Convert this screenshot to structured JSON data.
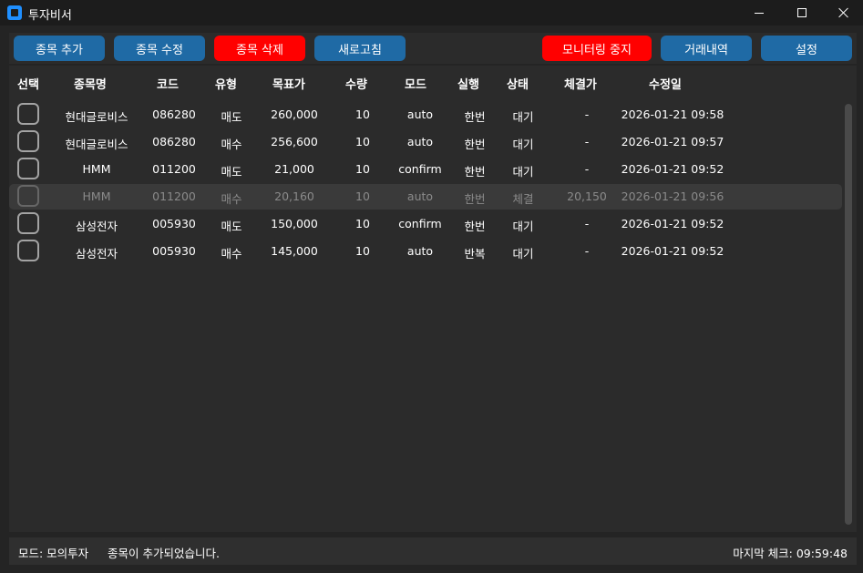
{
  "window": {
    "title": "투자비서",
    "controls": {
      "minimize": "minimize-icon",
      "maximize": "maximize-icon",
      "close": "close-icon"
    }
  },
  "toolbar": {
    "add_label": "종목 추가",
    "edit_label": "종목 수정",
    "delete_label": "종목 삭제",
    "refresh_label": "새로고침",
    "stop_monitor_label": "모니터링 중지",
    "history_label": "거래내역",
    "settings_label": "설정",
    "colors": {
      "primary": "#1f6aa5",
      "danger": "#ff0000"
    }
  },
  "table": {
    "headers": {
      "select": "선택",
      "name": "종목명",
      "code": "코드",
      "type": "유형",
      "target": "목표가",
      "qty": "수량",
      "mode": "모드",
      "exec": "실행",
      "status": "상태",
      "filled": "체결가",
      "modified": "수정일"
    },
    "rows": [
      {
        "name": "현대글로비스",
        "code": "086280",
        "type": "매도",
        "target": "260,000",
        "qty": "10",
        "mode": "auto",
        "exec": "한번",
        "status": "대기",
        "filled": "-",
        "modified": "2026-01-21 09:58",
        "dimmed": false
      },
      {
        "name": "현대글로비스",
        "code": "086280",
        "type": "매수",
        "target": "256,600",
        "qty": "10",
        "mode": "auto",
        "exec": "한번",
        "status": "대기",
        "filled": "-",
        "modified": "2026-01-21 09:57",
        "dimmed": false
      },
      {
        "name": "HMM",
        "code": "011200",
        "type": "매도",
        "target": "21,000",
        "qty": "10",
        "mode": "confirm",
        "exec": "한번",
        "status": "대기",
        "filled": "-",
        "modified": "2026-01-21 09:52",
        "dimmed": false
      },
      {
        "name": "HMM",
        "code": "011200",
        "type": "매수",
        "target": "20,160",
        "qty": "10",
        "mode": "auto",
        "exec": "한번",
        "status": "체결",
        "filled": "20,150",
        "modified": "2026-01-21 09:56",
        "dimmed": true
      },
      {
        "name": "삼성전자",
        "code": "005930",
        "type": "매도",
        "target": "150,000",
        "qty": "10",
        "mode": "confirm",
        "exec": "한번",
        "status": "대기",
        "filled": "-",
        "modified": "2026-01-21 09:52",
        "dimmed": false
      },
      {
        "name": "삼성전자",
        "code": "005930",
        "type": "매수",
        "target": "145,000",
        "qty": "10",
        "mode": "auto",
        "exec": "반복",
        "status": "대기",
        "filled": "-",
        "modified": "2026-01-21 09:52",
        "dimmed": false
      }
    ]
  },
  "statusbar": {
    "mode": "모드: 모의투자",
    "message": "종목이 추가되었습니다.",
    "last_check": "마지막 체크: 09:59:48"
  }
}
